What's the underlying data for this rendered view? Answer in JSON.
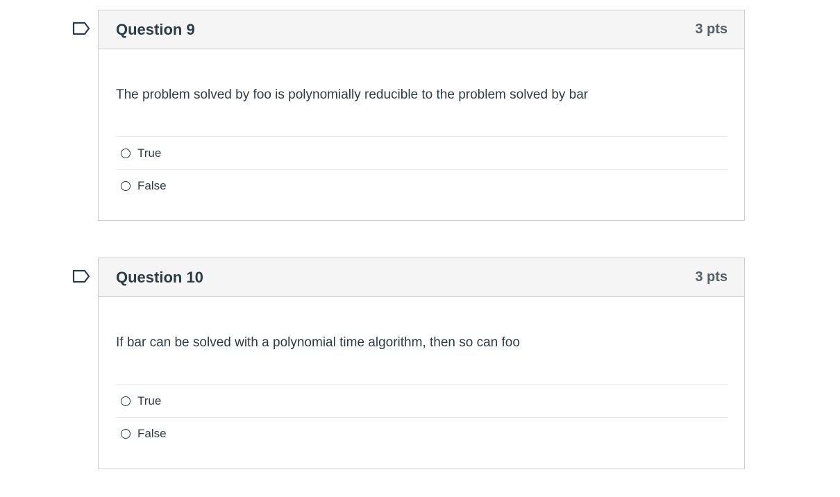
{
  "questions": [
    {
      "title": "Question 9",
      "points": "3 pts",
      "text": "The problem solved by foo is polynomially reducible to the problem solved by bar",
      "answers": [
        "True",
        "False"
      ],
      "flag_icon": "flag-outline-icon"
    },
    {
      "title": "Question 10",
      "points": "3 pts",
      "text": "If bar can be solved with a polynomial time algorithm, then so can foo",
      "answers": [
        "True",
        "False"
      ],
      "flag_icon": "flag-outline-icon"
    }
  ],
  "colors": {
    "text": "#2d3b45",
    "points": "#555f66",
    "border": "#c7cdd1",
    "header_bg": "#f5f5f5",
    "divider": "#e6e8ea",
    "flag": "#2d3b45"
  }
}
